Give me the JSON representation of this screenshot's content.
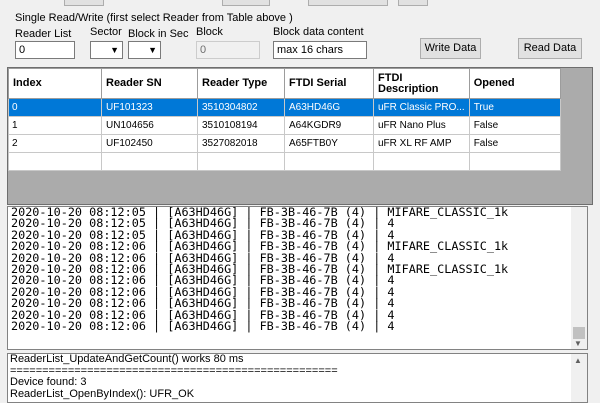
{
  "panel": {
    "title": "Single Read/Write  (first select Reader from Table above )",
    "reader_list_label": "Reader List",
    "reader_list_value": "0",
    "sector_label": "Sector",
    "block_in_sec_label": "Block in Sec",
    "block_label": "Block",
    "block_value": "0",
    "block_data_label": "Block data content",
    "block_data_value": "max 16 chars",
    "write_button": "Write Data",
    "read_button": "Read Data"
  },
  "grid": {
    "headers": [
      "Index",
      "Reader SN",
      "Reader Type",
      "FTDI Serial",
      "FTDI Description",
      "Opened"
    ],
    "rows": [
      [
        "0",
        "UF101323",
        "3510304802",
        "A63HD46G",
        "uFR Classic PRO...",
        "True"
      ],
      [
        "1",
        "UN104656",
        "3510108194",
        "A64KGDR9",
        "uFR Nano Plus",
        "False"
      ],
      [
        "2",
        "UF102450",
        "3527082018",
        "A65FTB0Y",
        "uFR XL RF AMP",
        "False"
      ],
      [
        "",
        "",
        "",
        "",
        "",
        ""
      ]
    ]
  },
  "log": {
    "lines": [
      "2020-10-20 08:12:05 | [A63HD46G] | FB-3B-46-7B (4) | MIFARE_CLASSIC_1k",
      "2020-10-20 08:12:05 | [A63HD46G] | FB-3B-46-7B (4) | 4",
      "2020-10-20 08:12:05 | [A63HD46G] | FB-3B-46-7B (4) | 4",
      "2020-10-20 08:12:06 | [A63HD46G] | FB-3B-46-7B (4) | MIFARE_CLASSIC_1k",
      "2020-10-20 08:12:06 | [A63HD46G] | FB-3B-46-7B (4) | 4",
      "2020-10-20 08:12:06 | [A63HD46G] | FB-3B-46-7B (4) | MIFARE_CLASSIC_1k",
      "2020-10-20 08:12:06 | [A63HD46G] | FB-3B-46-7B (4) | 4",
      "2020-10-20 08:12:06 | [A63HD46G] | FB-3B-46-7B (4) | 4",
      "2020-10-20 08:12:06 | [A63HD46G] | FB-3B-46-7B (4) | 4",
      "2020-10-20 08:12:06 | [A63HD46G] | FB-3B-46-7B (4) | 4",
      "2020-10-20 08:12:06 | [A63HD46G] | FB-3B-46-7B (4) | 4"
    ]
  },
  "status": {
    "lines": [
      "ReaderList_UpdateAndGetCount() works 80 ms",
      "===================================================",
      "Device found: 3",
      "ReaderList_OpenByIndex(): UFR_OK"
    ]
  },
  "colors": {
    "selection": "#0078d7",
    "grid_background": "#ababab"
  }
}
